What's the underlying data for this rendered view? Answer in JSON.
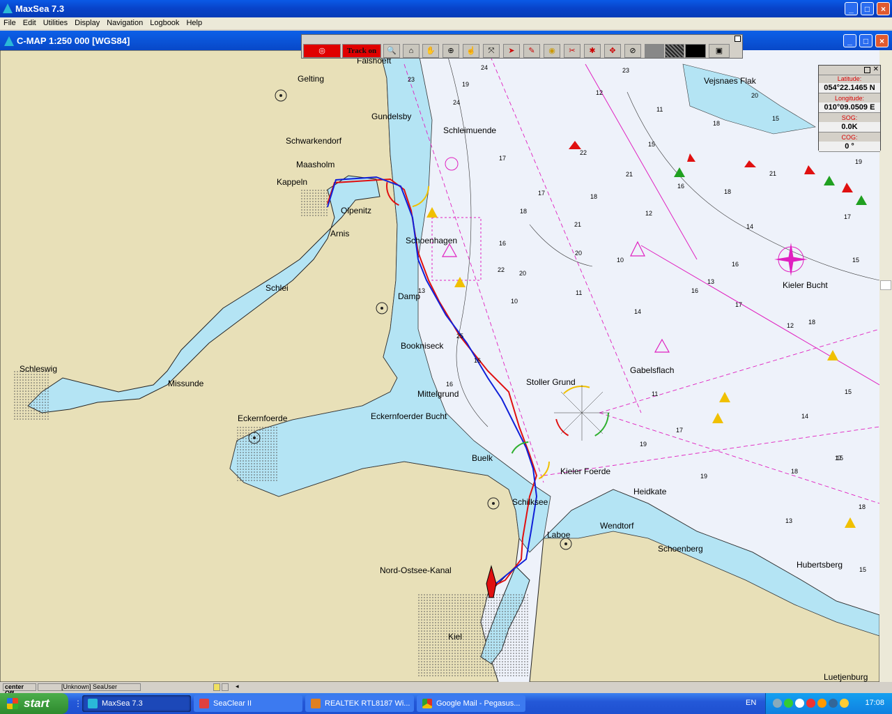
{
  "app": {
    "title": "MaxSea 7.3"
  },
  "menu": [
    "File",
    "Edit",
    "Utilities",
    "Display",
    "Navigation",
    "Logbook",
    "Help"
  ],
  "chart_window": {
    "title": "C-MAP  1:250 000 [WGS84]"
  },
  "toolbar": {
    "track_label": "Track on"
  },
  "position_panel": {
    "latitude_label": "Latitude:",
    "latitude_value": "054°22.1465 N",
    "longitude_label": "Longitude:",
    "longitude_value": "010°09.0509 E",
    "sog_label": "SOG:",
    "sog_value": "0.0K",
    "cog_label": "COG:",
    "cog_value": "0 °"
  },
  "places": [
    {
      "name": "Falshoeft"
    },
    {
      "name": "Gelting"
    },
    {
      "name": "Gundelsby"
    },
    {
      "name": "Schwarkendorf"
    },
    {
      "name": "Maasholm"
    },
    {
      "name": "Kappeln"
    },
    {
      "name": "Olpenitz"
    },
    {
      "name": "Arnis"
    },
    {
      "name": "Schleimuende"
    },
    {
      "name": "Schoenhagen"
    },
    {
      "name": "Schlei"
    },
    {
      "name": "Damp"
    },
    {
      "name": "Schleswig"
    },
    {
      "name": "Missunde"
    },
    {
      "name": "Bookniseck"
    },
    {
      "name": "Mittelgrund"
    },
    {
      "name": "Eckernfoerde"
    },
    {
      "name": "Eckernfoerder Bucht"
    },
    {
      "name": "Stoller Grund"
    },
    {
      "name": "Gabelsflach"
    },
    {
      "name": "Buelk"
    },
    {
      "name": "Kieler Foerde"
    },
    {
      "name": "Heidkate"
    },
    {
      "name": "Schilksee"
    },
    {
      "name": "Wendtorf"
    },
    {
      "name": "Laboe"
    },
    {
      "name": "Schoenberg"
    },
    {
      "name": "Nord-Ostsee-Kanal"
    },
    {
      "name": "Hubertsberg"
    },
    {
      "name": "Kiel"
    },
    {
      "name": "Luetjenburg"
    },
    {
      "name": "Vejsnaes Flak"
    },
    {
      "name": "Kieler Bucht"
    }
  ],
  "depths": [
    "24",
    "23",
    "19",
    "24",
    "12",
    "23",
    "11",
    "18",
    "20",
    "15",
    "22",
    "21",
    "17",
    "15",
    "18",
    "16",
    "21",
    "18",
    "12",
    "19",
    "17",
    "18",
    "21",
    "20",
    "16",
    "10",
    "14",
    "17",
    "15",
    "13",
    "16",
    "16",
    "17",
    "11",
    "13",
    "14",
    "12",
    "10",
    "16",
    "19",
    "13",
    "18",
    "17",
    "15",
    "11",
    "19",
    "18",
    "22",
    "15",
    "17",
    "18",
    "20",
    "16",
    "25",
    "15",
    "14"
  ],
  "statusbar": {
    "center": "center Off",
    "user": "[Unknown] SeaUser"
  },
  "taskbar": {
    "start": "start",
    "tasks": [
      "MaxSea 7.3",
      "SeaClear II",
      "REALTEK RTL8187 Wi...",
      "Google Mail - Pegasus..."
    ],
    "lang": "EN",
    "clock": "17:08"
  },
  "colors": {
    "land": "#e8e0b8",
    "shallow": "#b4e4f4",
    "deep": "#eef2fa",
    "track_red": "#e01010",
    "track_blue": "#1020d8",
    "magenta": "#e020c0"
  }
}
